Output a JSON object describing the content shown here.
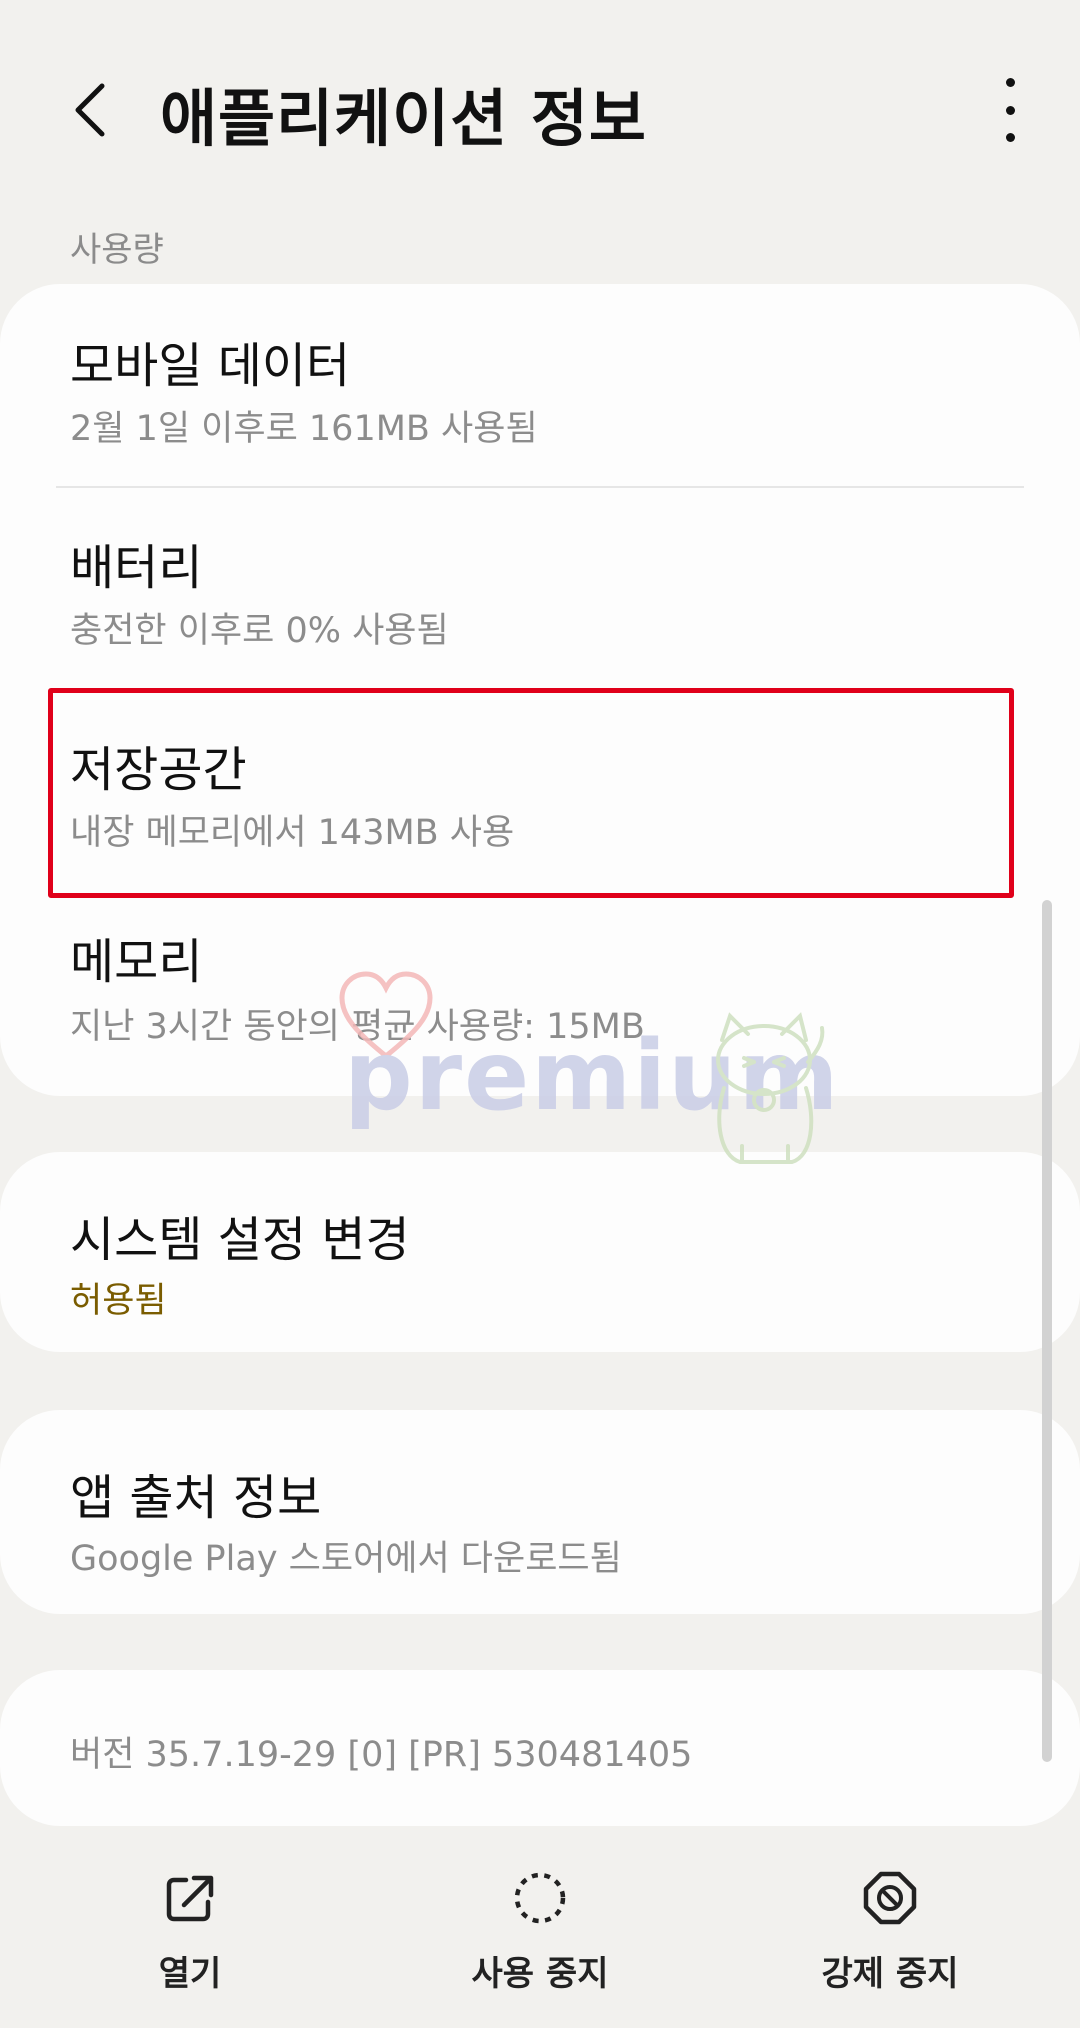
{
  "header": {
    "title": "애플리케이션 정보"
  },
  "section_label": "사용량",
  "usage_items": [
    {
      "title": "모바일 데이터",
      "subtitle": "2월 1일 이후로 161MB 사용됨"
    },
    {
      "title": "배터리",
      "subtitle": "충전한 이후로 0% 사용됨"
    },
    {
      "title": "저장공간",
      "subtitle": "내장 메모리에서 143MB 사용"
    },
    {
      "title": "메모리",
      "subtitle": "지난 3시간 동안의 평균 사용량: 15MB"
    }
  ],
  "system_settings": {
    "title": "시스템 설정 변경",
    "subtitle": "허용됨"
  },
  "app_source": {
    "title": "앱 출처 정보",
    "subtitle": "Google Play 스토어에서 다운로드됨"
  },
  "version": "버전 35.7.19-29 [0] [PR] 530481405",
  "watermark": "premium",
  "bottom_actions": [
    {
      "label": "열기",
      "icon": "open-external-icon"
    },
    {
      "label": "사용 중지",
      "icon": "dashed-circle-icon"
    },
    {
      "label": "강제 중지",
      "icon": "force-stop-icon"
    }
  ],
  "colors": {
    "background": "#f2f1ee",
    "card": "#fdfdfd",
    "highlight": "#e0001a",
    "accent_text": "#7a5c00"
  }
}
